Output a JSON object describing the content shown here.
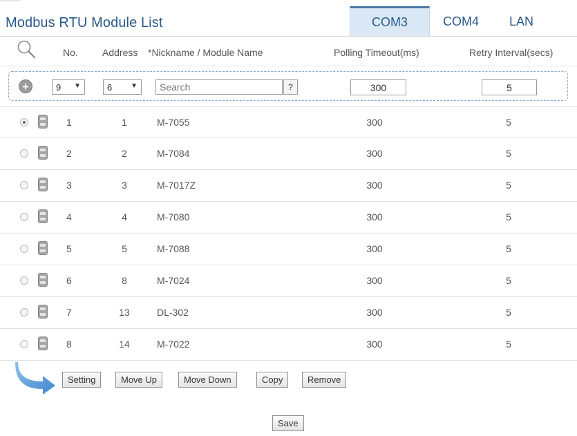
{
  "page": {
    "title": "Modbus RTU Module List"
  },
  "tabs": [
    {
      "label": "COM3",
      "active": true
    },
    {
      "label": "COM4",
      "active": false
    },
    {
      "label": "LAN",
      "active": false
    }
  ],
  "columns": {
    "no": "No.",
    "address": "Address",
    "name": "*Nickname / Module Name",
    "polling": "Polling Timeout(ms)",
    "retry": "Retry Interval(secs)"
  },
  "add_row": {
    "no_value": "9",
    "address_value": "6",
    "search_placeholder": "Search",
    "help_label": "?",
    "polling_value": "300",
    "retry_value": "5"
  },
  "modules": [
    {
      "no": "1",
      "address": "1",
      "name": "M-7055",
      "polling": "300",
      "retry": "5",
      "selected": true
    },
    {
      "no": "2",
      "address": "2",
      "name": "M-7084",
      "polling": "300",
      "retry": "5",
      "selected": false
    },
    {
      "no": "3",
      "address": "3",
      "name": "M-7017Z",
      "polling": "300",
      "retry": "5",
      "selected": false
    },
    {
      "no": "4",
      "address": "4",
      "name": "M-7080",
      "polling": "300",
      "retry": "5",
      "selected": false
    },
    {
      "no": "5",
      "address": "5",
      "name": "M-7088",
      "polling": "300",
      "retry": "5",
      "selected": false
    },
    {
      "no": "6",
      "address": "8",
      "name": "M-7024",
      "polling": "300",
      "retry": "5",
      "selected": false
    },
    {
      "no": "7",
      "address": "13",
      "name": "DL-302",
      "polling": "300",
      "retry": "5",
      "selected": false
    },
    {
      "no": "8",
      "address": "14",
      "name": "M-7022",
      "polling": "300",
      "retry": "5",
      "selected": false
    }
  ],
  "actions": {
    "setting": "Setting",
    "move_up": "Move Up",
    "move_down": "Move Down",
    "copy": "Copy",
    "remove": "Remove"
  },
  "save_label": "Save",
  "icons": {
    "search": "search-icon",
    "add": "plus-circle-icon",
    "module": "module-icon",
    "apply_arrow": "curved-arrow-icon"
  },
  "colors": {
    "title": "#2a5a8a",
    "active_tab_bg": "#dbe8f5",
    "active_tab_border": "#4a77a6",
    "add_row_border": "#86a8cf",
    "arrow": "#5b9ad6"
  }
}
